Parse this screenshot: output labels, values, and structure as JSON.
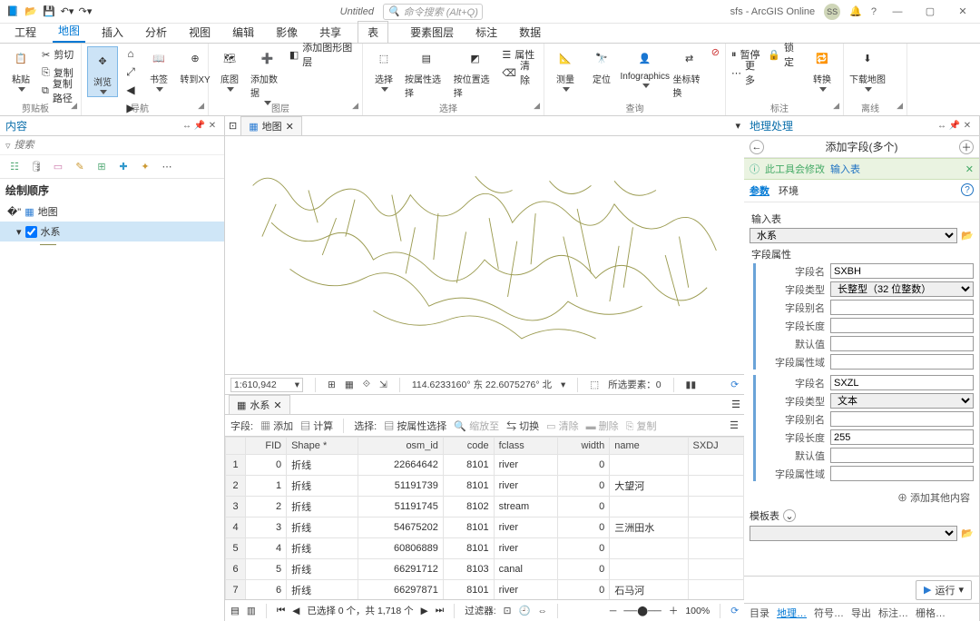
{
  "title_bar": {
    "doc_title": "Untitled",
    "search_placeholder": "命令搜索 (Alt+Q)",
    "user": "sfs - ArcGIS Online",
    "avatar": "SS"
  },
  "ribbon_tabs": [
    "工程",
    "地图",
    "插入",
    "分析",
    "视图",
    "编辑",
    "影像",
    "共享",
    "表",
    "要素图层",
    "标注",
    "数据"
  ],
  "ribbon_active": 1,
  "ribbon_groups": {
    "clipboard": {
      "label": "剪贴板",
      "paste": "粘贴",
      "cut": "剪切",
      "copy": "复制",
      "copy_path": "复制路径"
    },
    "nav": {
      "label": "导航",
      "explore": "浏览",
      "bookmark": "书签",
      "goto": "转到XY"
    },
    "layer": {
      "label": "图层",
      "basemap": "底图",
      "adddata": "添加数据",
      "addgfx": "添加图形图层"
    },
    "select": {
      "label": "选择",
      "select": "选择",
      "sel_attr": "按属性选择",
      "sel_loc": "按位置选择",
      "props": "属性",
      "clear": "清除"
    },
    "inquiry": {
      "label": "查询",
      "measure": "测量",
      "locate": "定位",
      "info": "Infographics",
      "coord": "坐标转换"
    },
    "label": {
      "label": "标注",
      "pause": "暂停",
      "lock": "锁定",
      "more": "更多",
      "convert": "转换"
    },
    "offline": {
      "label": "离线",
      "download": "下载地图"
    }
  },
  "contents": {
    "title": "内容",
    "search": "搜索",
    "draw_order": "绘制顺序",
    "map_name": "地图",
    "layer": "水系"
  },
  "map": {
    "tab": "地图",
    "scale": "1:610,942",
    "coords": "114.6233160° 东 22.6075276° 北",
    "sel": "所选要素：0",
    "sel_label": "所选要素"
  },
  "attr": {
    "tab": "水系",
    "toolbar": {
      "field": "字段:",
      "add": "添加",
      "calc": "计算",
      "select": "选择:",
      "by_attr": "按属性选择",
      "zoom": "缩放至",
      "switch": "切换",
      "clear": "清除",
      "delete": "删除",
      "copy": "复制"
    },
    "columns": [
      "FID",
      "Shape *",
      "osm_id",
      "code",
      "fclass",
      "width",
      "name",
      "SXDJ"
    ],
    "rows": [
      {
        "n": 1,
        "FID": 0,
        "Shape": "折线",
        "osm_id": "22664642",
        "code": 8101,
        "fclass": "river",
        "width": 0,
        "name": "",
        "SXDJ": ""
      },
      {
        "n": 2,
        "FID": 1,
        "Shape": "折线",
        "osm_id": "51191739",
        "code": 8101,
        "fclass": "river",
        "width": 0,
        "name": "大望河",
        "SXDJ": ""
      },
      {
        "n": 3,
        "FID": 2,
        "Shape": "折线",
        "osm_id": "51191745",
        "code": 8102,
        "fclass": "stream",
        "width": 0,
        "name": "",
        "SXDJ": ""
      },
      {
        "n": 4,
        "FID": 3,
        "Shape": "折线",
        "osm_id": "54675202",
        "code": 8101,
        "fclass": "river",
        "width": 0,
        "name": "三洲田水",
        "SXDJ": ""
      },
      {
        "n": 5,
        "FID": 4,
        "Shape": "折线",
        "osm_id": "60806889",
        "code": 8101,
        "fclass": "river",
        "width": 0,
        "name": "",
        "SXDJ": ""
      },
      {
        "n": 6,
        "FID": 5,
        "Shape": "折线",
        "osm_id": "66291712",
        "code": 8103,
        "fclass": "canal",
        "width": 0,
        "name": "",
        "SXDJ": ""
      },
      {
        "n": 7,
        "FID": 6,
        "Shape": "折线",
        "osm_id": "66297871",
        "code": 8101,
        "fclass": "river",
        "width": 0,
        "name": "石马河",
        "SXDJ": ""
      }
    ],
    "status": {
      "selected": "已选择 0 个，共 1,718 个",
      "filter": "过滤器:",
      "zoom": "100%"
    }
  },
  "gp": {
    "title": "地理处理",
    "tool": "添加字段(多个)",
    "warn_prefix": "此工具会修改",
    "warn_link": "输入表",
    "tabs": {
      "params": "参数",
      "env": "环境"
    },
    "labels": {
      "input": "输入表",
      "field_props": "字段属性",
      "fname": "字段名",
      "ftype": "字段类型",
      "falias": "字段别名",
      "flen": "字段长度",
      "fdefault": "默认值",
      "fdomain": "字段属性域",
      "add_more": "添加其他内容",
      "template": "模板表",
      "run": "运行"
    },
    "input_value": "水系",
    "f1": {
      "name": "SXBH",
      "type": "长整型（32 位整数）"
    },
    "f2": {
      "name": "SXZL",
      "type": "文本",
      "len": "255"
    },
    "bottom_tabs": [
      "目录",
      "地理…",
      "符号…",
      "导出",
      "标注…",
      "栅格…"
    ]
  }
}
